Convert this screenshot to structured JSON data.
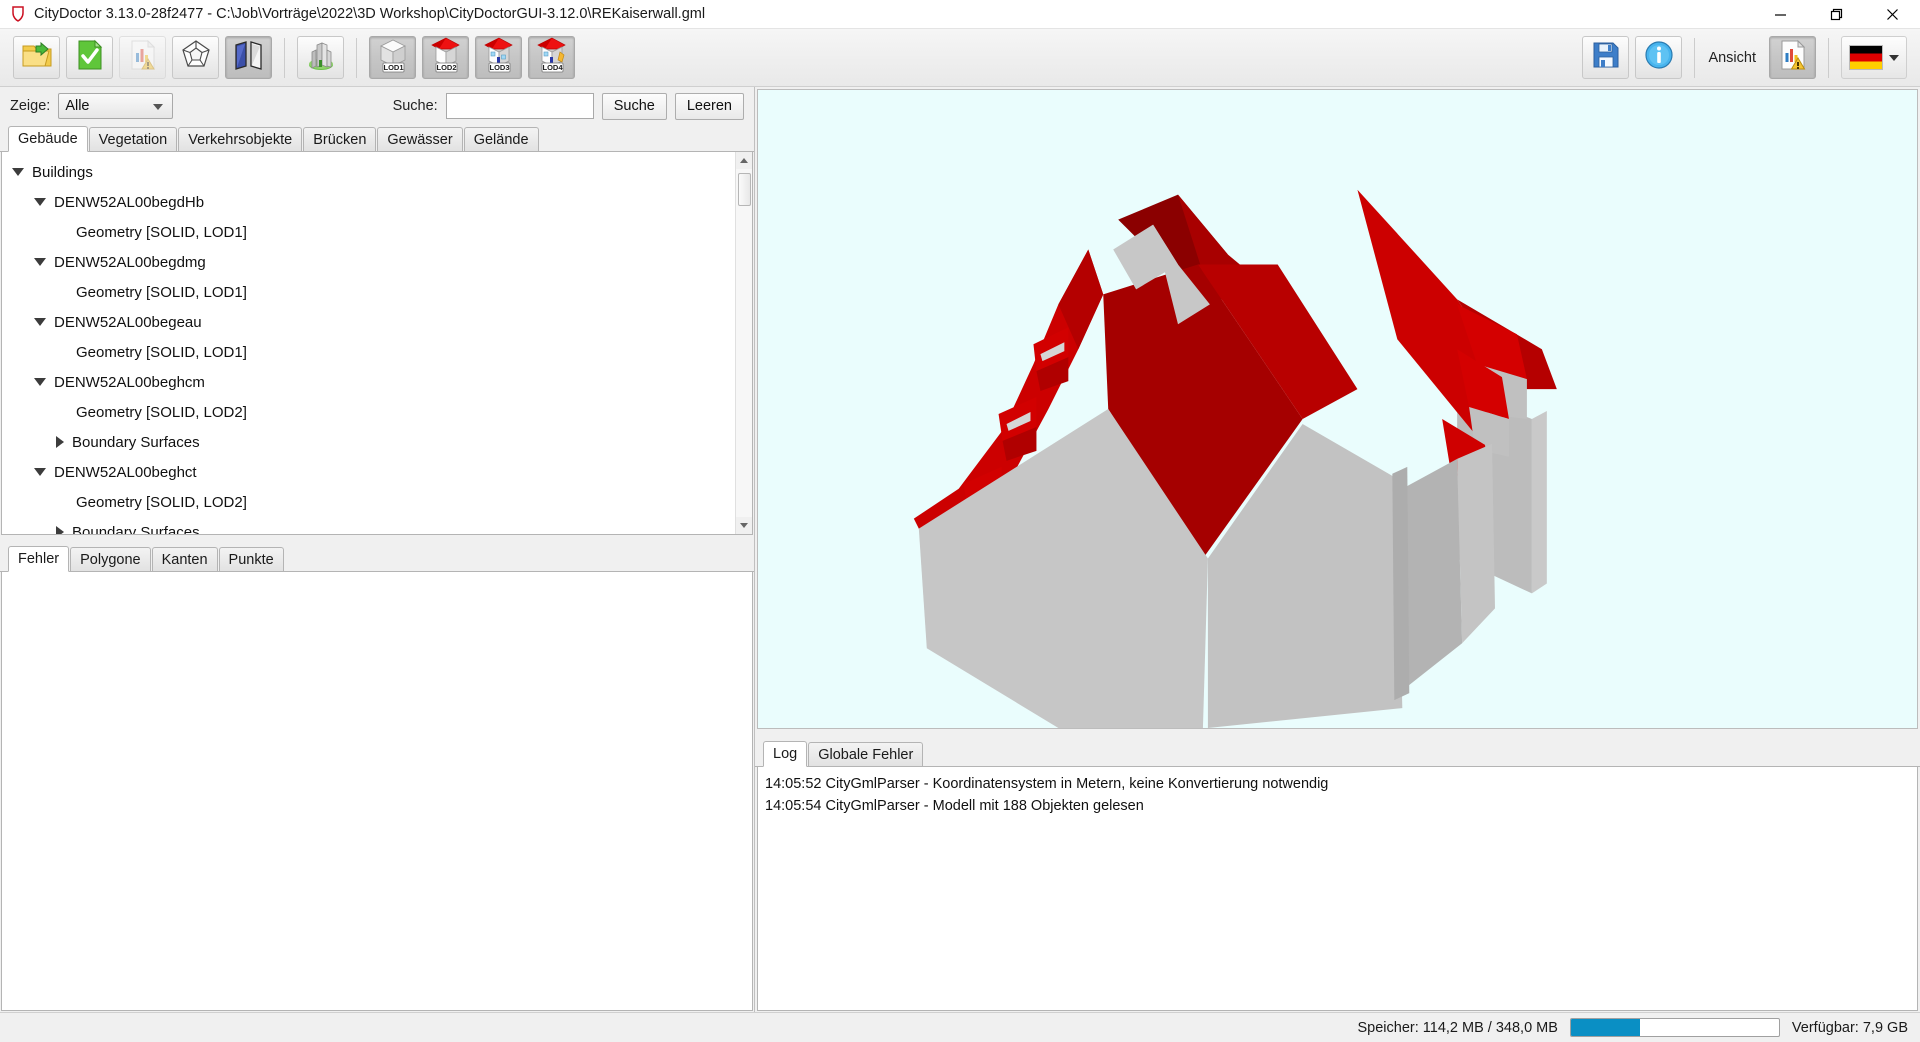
{
  "window": {
    "title": "CityDoctor 3.13.0-28f2477 - C:\\Job\\Vorträge\\2022\\3D Workshop\\CityDoctorGUI-3.12.0\\REKaiserwall.gml",
    "app_icon": "shield-icon",
    "minimize_label": "—",
    "maximize_label": "❐",
    "close_label": "✕"
  },
  "toolbar": {
    "buttons": [
      {
        "name": "open-file-button",
        "icon": "folder-open-icon",
        "state": "normal"
      },
      {
        "name": "validate-button",
        "icon": "document-check-icon",
        "state": "normal"
      },
      {
        "name": "report-button",
        "icon": "report-warning-icon",
        "state": "disabled"
      },
      {
        "name": "polyhedron-button",
        "icon": "polyhedron-icon",
        "state": "normal"
      },
      {
        "name": "planes-button",
        "icon": "planes-icon",
        "state": "pressed"
      },
      {
        "name": "city-model-button",
        "icon": "city-buildings-icon",
        "state": "normal"
      },
      {
        "name": "lod1-button",
        "icon": "lod1-cube-icon",
        "state": "pressed",
        "badge": "LOD1"
      },
      {
        "name": "lod2-button",
        "icon": "lod2-house-icon",
        "state": "pressed",
        "badge": "LOD2"
      },
      {
        "name": "lod3-button",
        "icon": "lod3-house-icon",
        "state": "pressed",
        "badge": "LOD3"
      },
      {
        "name": "lod4-button",
        "icon": "lod4-house-icon",
        "state": "pressed",
        "badge": "LOD4"
      }
    ],
    "save_icon": "floppy-save-icon",
    "info_icon": "info-circle-icon",
    "view_label": "Ansicht",
    "view_report_icon": "report-warning-icon",
    "language_flag": "german-flag-icon",
    "language_caret": "chevron-down-icon"
  },
  "filter": {
    "show_label": "Zeige:",
    "show_value": "Alle",
    "search_label": "Suche:",
    "search_value": "",
    "search_placeholder": "",
    "search_button": "Suche",
    "clear_button": "Leeren"
  },
  "object_tabs": {
    "active": 0,
    "items": [
      {
        "label": "Gebäude"
      },
      {
        "label": "Vegetation"
      },
      {
        "label": "Verkehrsobjekte"
      },
      {
        "label": "Brücken"
      },
      {
        "label": "Gewässer"
      },
      {
        "label": "Gelände"
      }
    ]
  },
  "tree": {
    "rows": [
      {
        "label": "Buildings",
        "indent": 0,
        "toggle": "down"
      },
      {
        "label": "DENW52AL00begdHb",
        "indent": 1,
        "toggle": "down"
      },
      {
        "label": "Geometry [SOLID, LOD1]",
        "indent": 2,
        "toggle": "none"
      },
      {
        "label": "DENW52AL00begdmg",
        "indent": 1,
        "toggle": "down"
      },
      {
        "label": "Geometry [SOLID, LOD1]",
        "indent": 2,
        "toggle": "none"
      },
      {
        "label": "DENW52AL00begeau",
        "indent": 1,
        "toggle": "down"
      },
      {
        "label": "Geometry [SOLID, LOD1]",
        "indent": 2,
        "toggle": "none"
      },
      {
        "label": "DENW52AL00beghcm",
        "indent": 1,
        "toggle": "down"
      },
      {
        "label": "Geometry [SOLID, LOD2]",
        "indent": 2,
        "toggle": "none"
      },
      {
        "label": "Boundary Surfaces",
        "indent": 2,
        "toggle": "right"
      },
      {
        "label": "DENW52AL00beghct",
        "indent": 1,
        "toggle": "down"
      },
      {
        "label": "Geometry [SOLID, LOD2]",
        "indent": 2,
        "toggle": "none"
      },
      {
        "label": "Boundary Surfaces",
        "indent": 2,
        "toggle": "right"
      }
    ]
  },
  "issue_tabs": {
    "active": 0,
    "items": [
      {
        "label": "Fehler"
      },
      {
        "label": "Polygone"
      },
      {
        "label": "Kanten"
      },
      {
        "label": "Punkte"
      }
    ]
  },
  "viewport": {
    "background_color": "#eafdfd",
    "wall_color": "#c6c6c6",
    "wall_shadow_color": "#b3b3b3",
    "roof_color": "#cc0000",
    "roof_dark_color": "#8b0000",
    "roof_light_color": "#e01010"
  },
  "log_tabs": {
    "active": 0,
    "items": [
      {
        "label": "Log"
      },
      {
        "label": "Globale Fehler"
      }
    ]
  },
  "log": {
    "lines": [
      "14:05:52 CityGmlParser - Koordinatensystem in Metern, keine Konvertierung notwendig",
      "14:05:54 CityGmlParser - Modell mit 188 Objekten gelesen"
    ]
  },
  "statusbar": {
    "memory_label": "Speicher:  114,2 MB / 348,0 MB",
    "memory_percent": 33,
    "memory_fill_color": "#0a8fc4",
    "available_label": "Verfügbar: 7,9 GB"
  }
}
